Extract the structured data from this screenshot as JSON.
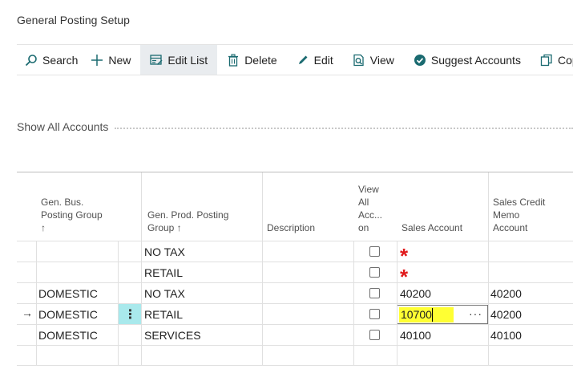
{
  "page": {
    "title": "General Posting Setup"
  },
  "toolbar": {
    "search": "Search",
    "new": "New",
    "edit_list": "Edit List",
    "delete": "Delete",
    "edit": "Edit",
    "view": "View",
    "suggest_accounts": "Suggest Accounts",
    "copy": "Cop"
  },
  "show_all_accounts": "Show All Accounts",
  "columns": {
    "gen_bus_posting_group": [
      "Gen. Bus.",
      "Posting Group",
      "↑"
    ],
    "gen_prod_posting_group": [
      "Gen. Prod. Posting",
      "Group ↑"
    ],
    "description": "Description",
    "view_all_accounts": [
      "View",
      "All",
      "Acc...",
      "on"
    ],
    "sales_account": "Sales Account",
    "sales_credit_memo_account": [
      "Sales Credit",
      "Memo",
      "Account"
    ]
  },
  "rows": [
    {
      "bus": "",
      "prod": "NO TAX",
      "desc": "",
      "sales": "*",
      "credit": ""
    },
    {
      "bus": "",
      "prod": "RETAIL",
      "desc": "",
      "sales": "*",
      "credit": ""
    },
    {
      "bus": "DOMESTIC",
      "prod": "NO TAX",
      "desc": "",
      "sales": "40200",
      "credit": "40200"
    },
    {
      "bus": "DOMESTIC",
      "prod": "RETAIL",
      "desc": "",
      "sales": "10700",
      "credit": "40200"
    },
    {
      "bus": "DOMESTIC",
      "prod": "SERVICES",
      "desc": "",
      "sales": "40100",
      "credit": "40100"
    },
    {
      "bus": "",
      "prod": "",
      "desc": "",
      "sales": "",
      "credit": ""
    }
  ],
  "active_row_indicator": "→",
  "row_menu_glyph": "⋮",
  "lookup_glyph": "···",
  "colors": {
    "highlight": "#ffff33",
    "active_row_menu": "#a9e9ec",
    "required": "#e0191b",
    "toolbar_active": "#e9ecef",
    "icon_accent": "#1a6a70"
  }
}
